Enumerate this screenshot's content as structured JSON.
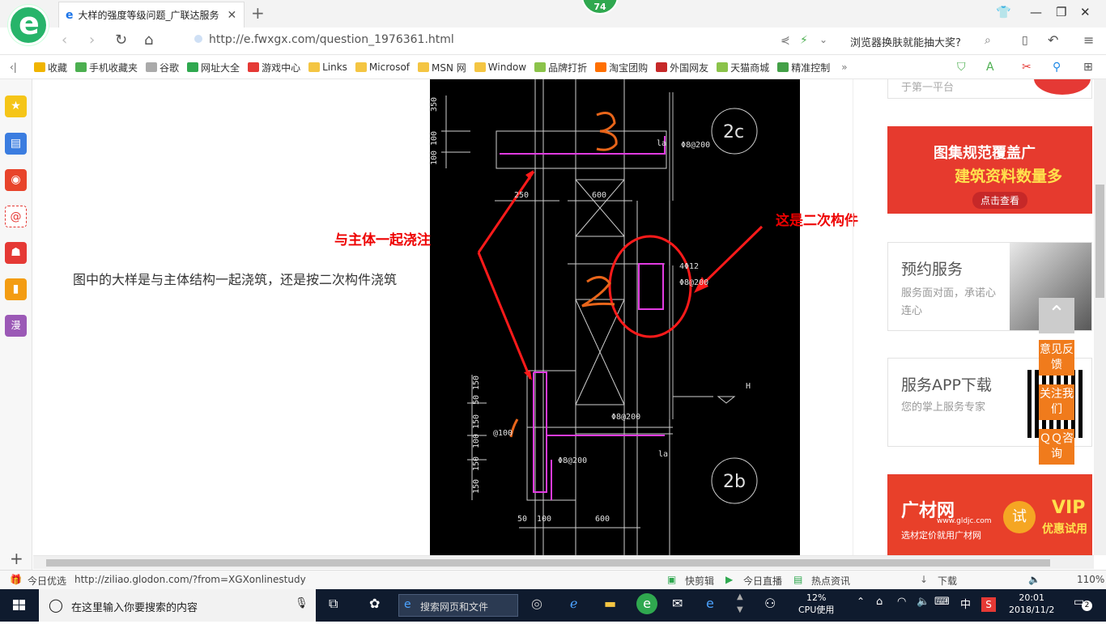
{
  "browser": {
    "tab_title": "大样的强度等级问题_广联达服务",
    "notification_count": "74",
    "url": "http://e.fwxgx.com/question_1976361.html",
    "promo_text": "浏览器换肤就能抽大奖?"
  },
  "bookmarks": [
    {
      "label": "收藏",
      "color": "#f0b400"
    },
    {
      "label": "手机收藏夹",
      "color": "#4caf50"
    },
    {
      "label": "谷歌",
      "color": "#aaaaaa"
    },
    {
      "label": "网址大全",
      "color": "#2fa84f"
    },
    {
      "label": "游戏中心",
      "color": "#e53935"
    },
    {
      "label": "Links",
      "color": "#f4c542"
    },
    {
      "label": "Microsof",
      "color": "#f4c542"
    },
    {
      "label": "MSN 网",
      "color": "#f4c542"
    },
    {
      "label": "Window",
      "color": "#f4c542"
    },
    {
      "label": "品牌打折",
      "color": "#8bc34a"
    },
    {
      "label": "淘宝团购",
      "color": "#ff6f00"
    },
    {
      "label": "外国网友",
      "color": "#c62828"
    },
    {
      "label": "天猫商城",
      "color": "#8bc34a"
    },
    {
      "label": "精准控制",
      "color": "#43a047"
    }
  ],
  "page": {
    "question_text": "图中的大样是与主体结构一起浇筑，还是按二次构件浇筑",
    "annotation_left": "与主体一起浇注",
    "annotation_right": "这是二次构件",
    "drawing_labels": {
      "dim_350": "350",
      "dim_100a": "100",
      "dim_100b": "100",
      "dim_250": "250",
      "dim_600a": "600",
      "tag_2c": "2c",
      "rebar_top": "Φ8@200",
      "rebar_4": "4Φ12",
      "rebar_mid": "Φ8@200",
      "dim_150a": "150",
      "dim_50": "50",
      "dim_150b": "150",
      "dim_100c": "100",
      "dim_150c": "150",
      "dim_150d": "150",
      "rebar_low1": "Φ8@200",
      "rebar_low2": "Φ8@200",
      "rebar_left": "@100",
      "tag_2b": "2b",
      "dim_50b": "50",
      "dim_100d": "100",
      "dim_600b": "600",
      "mark_h": "H",
      "mark_la1": "la",
      "mark_la2": "la"
    }
  },
  "right_ads": {
    "top_ad_text": "于第一平台",
    "ad1_line1": "图集规范覆盖广",
    "ad1_line2": "建筑资料数量多",
    "ad1_button": "点击查看",
    "ad2_title": "预约服务",
    "ad2_sub": "服务面对面，承诺心连心",
    "ad3_title": "服务APP下载",
    "ad3_sub": "您的掌上服务专家",
    "ad4_brand": "广材网",
    "ad4_url": "www.gldjc.com",
    "ad4_slogan": "选材定价就用广材网",
    "ad4_badge": "试",
    "ad4_vip": "VIP",
    "ad4_vip_sub": "优惠试用"
  },
  "side_tools": {
    "feedback": "意见反馈",
    "follow": "关注我们",
    "qq": "ＱＱ咨询"
  },
  "statusbar": {
    "left": "今日优选",
    "link": "http://ziliao.glodon.com/?from=XGXonlinestudy",
    "items": [
      "快剪辑",
      "今日直播",
      "热点资讯",
      "下载"
    ],
    "zoom": "110%"
  },
  "taskbar": {
    "search_placeholder": "在这里输入你要搜索的内容",
    "web_search": "搜索网页和文件",
    "cpu_percent": "12%",
    "cpu_label": "CPU使用",
    "ime": "中",
    "time": "20:01",
    "date": "2018/11/2",
    "notifications": "2"
  }
}
